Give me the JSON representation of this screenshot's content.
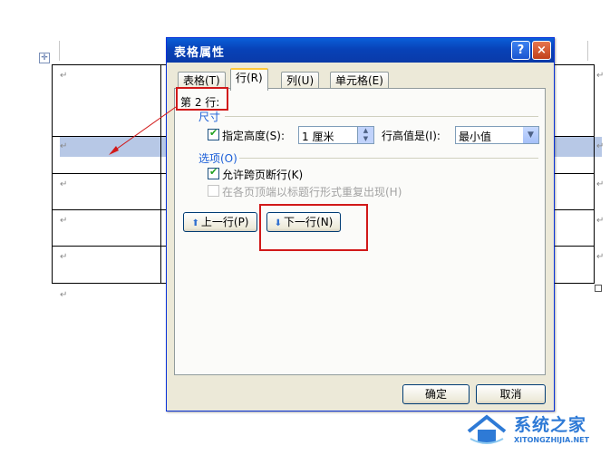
{
  "dialog": {
    "title": "表格属性",
    "help_icon": "?",
    "close_icon": "×",
    "tabs": [
      {
        "label": "表格(T)"
      },
      {
        "label": "行(R)"
      },
      {
        "label": "列(U)"
      },
      {
        "label": "单元格(E)"
      }
    ],
    "active_tab": "行(R)",
    "row_label": "第 2 行:",
    "size_section": "尺寸",
    "specify_height_label": "指定高度(S):",
    "specify_height_checked": true,
    "height_value": "1 厘米",
    "row_height_is_label": "行高值是(I):",
    "row_height_mode": "最小值",
    "options_section": "选项(O)",
    "allow_break_label": "允许跨页断行(K)",
    "allow_break_checked": true,
    "repeat_header_label": "在各页顶端以标题行形式重复出现(H)",
    "repeat_header_checked": false,
    "prev_row_button": "上一行(P)",
    "next_row_button": "下一行(N)",
    "ok_button": "确定",
    "cancel_button": "取消"
  },
  "document": {
    "paragraph_mark": "↵"
  },
  "watermark": {
    "brand": "系统之家",
    "url": "XITONGZHIJIA.NET"
  },
  "colors": {
    "title_bar": "#0a4fc8",
    "annotation_red": "#d11919",
    "selected_row": "#b7c8e6"
  }
}
